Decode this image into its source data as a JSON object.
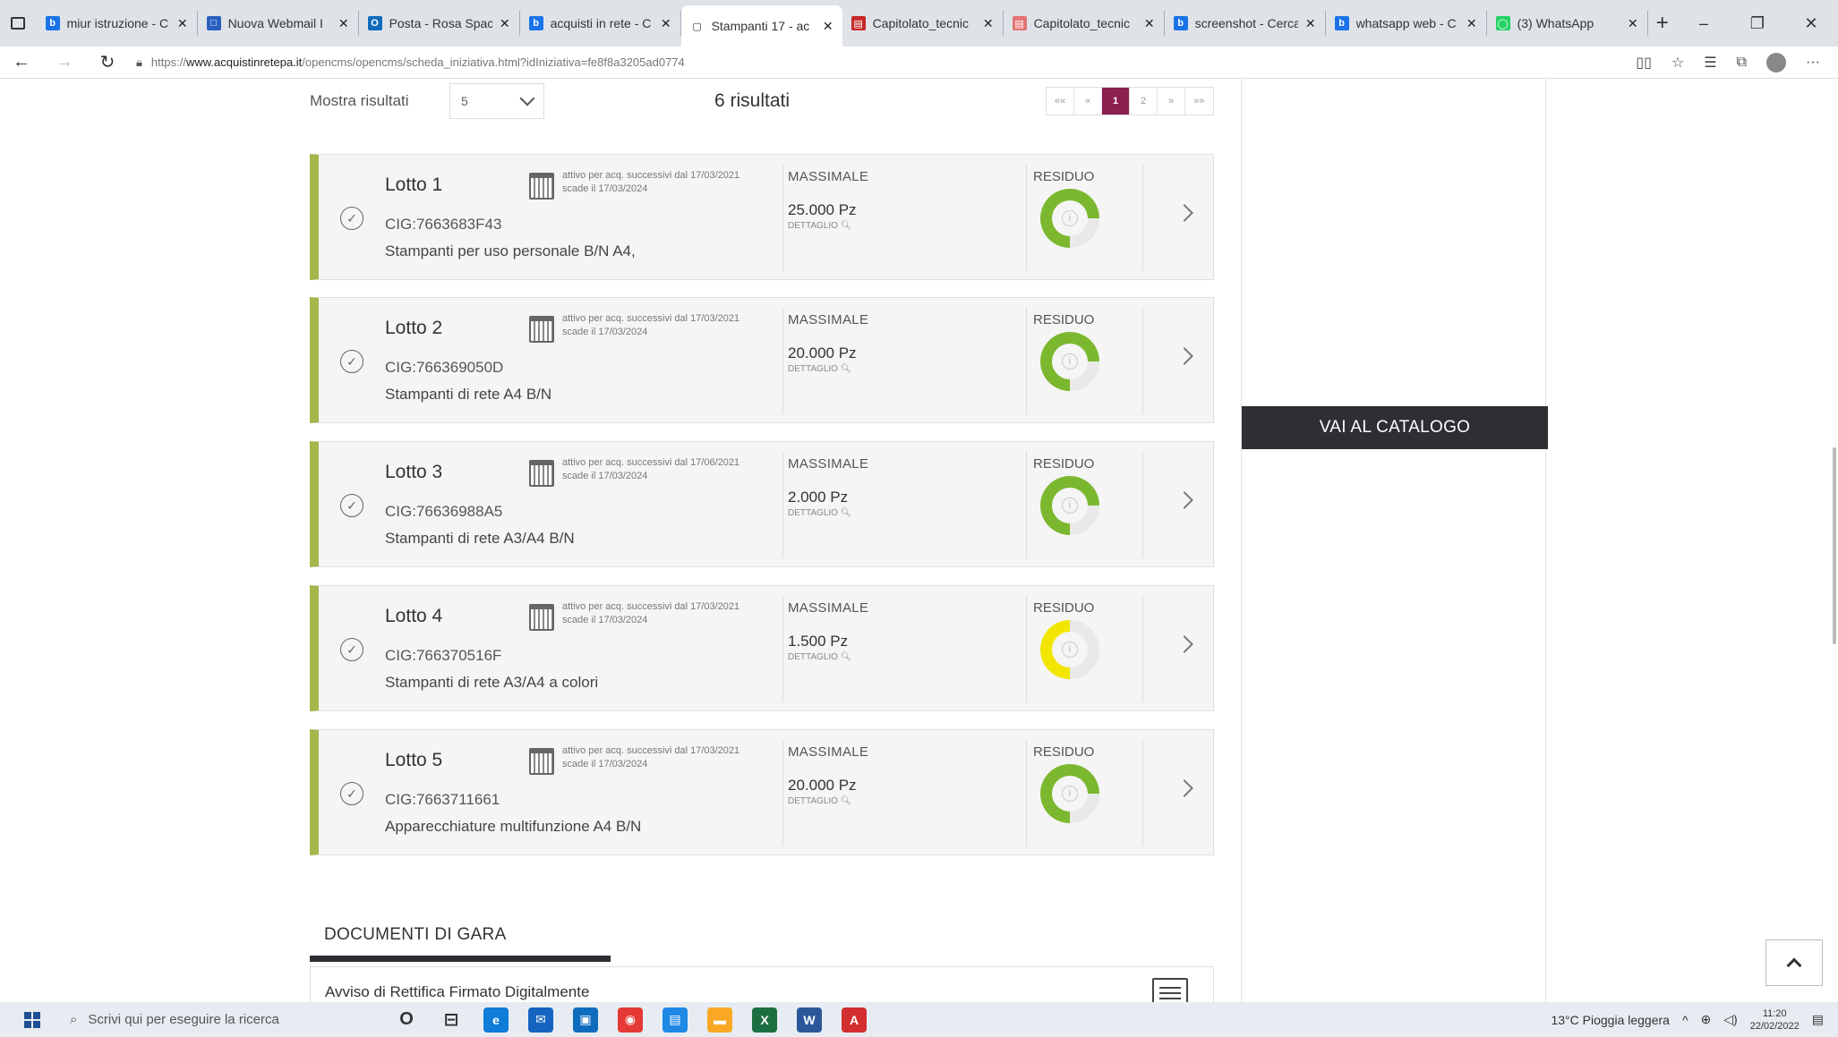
{
  "browser": {
    "tabs": [
      {
        "title": "miur istruzione - C",
        "color": "#1a73e8",
        "glyph": "b"
      },
      {
        "title": "Nuova Webmail I",
        "color": "#2b5fbf",
        "glyph": "□"
      },
      {
        "title": "Posta - Rosa Spac",
        "color": "#0f6cbd",
        "glyph": "O"
      },
      {
        "title": "acquisti in rete - C",
        "color": "#1a73e8",
        "glyph": "b"
      },
      {
        "title": "Stampanti 17 - ac",
        "color": "#ffffff",
        "glyph": "▢",
        "active": true
      },
      {
        "title": "Capitolato_tecnic",
        "color": "#c62828",
        "glyph": "▤"
      },
      {
        "title": "Capitolato_tecnic",
        "color": "#e57373",
        "glyph": "▤"
      },
      {
        "title": "screenshot - Cerca",
        "color": "#1a73e8",
        "glyph": "b"
      },
      {
        "title": "whatsapp web - C",
        "color": "#1a73e8",
        "glyph": "b"
      },
      {
        "title": "(3) WhatsApp",
        "color": "#25d366",
        "glyph": "◯"
      }
    ],
    "url_prefix": "https://",
    "url_domain": "www.acquistinretepa.it",
    "url_path": "/opencms/opencms/scheda_iniziativa.html?idIniziativa=fe8f8a3205ad0774"
  },
  "results": {
    "show_label": "Mostra risultati",
    "per_page": "5",
    "count_text": "6 risultati",
    "pager": [
      "««",
      "«",
      "1",
      "2",
      "»",
      "»»"
    ],
    "current_page": "1"
  },
  "lotti": [
    {
      "title": "Lotto 1",
      "cig": "CIG:7663683F43",
      "desc": "Stampanti per uso personale B/N A4,",
      "date1": "attivo per acq. successivi dal 17/03/2021",
      "date2": "scade il 17/03/2024",
      "massimale_label": "MASSIMALE",
      "massimale": "25.000 Pz",
      "dettaglio": "DETTAGLIO",
      "residuo_label": "RESIDUO",
      "residuo_pct": 0.75,
      "color": "#7cb82f"
    },
    {
      "title": "Lotto 2",
      "cig": "CIG:766369050D",
      "desc": "Stampanti di rete A4 B/N",
      "date1": "attivo per acq. successivi dal 17/03/2021",
      "date2": "scade il 17/03/2024",
      "massimale_label": "MASSIMALE",
      "massimale": "20.000 Pz",
      "dettaglio": "DETTAGLIO",
      "residuo_label": "RESIDUO",
      "residuo_pct": 0.75,
      "color": "#7cb82f"
    },
    {
      "title": "Lotto 3",
      "cig": "CIG:76636988A5",
      "desc": "Stampanti di rete A3/A4 B/N",
      "date1": "attivo per acq. successivi dal 17/06/2021",
      "date2": "scade il 17/03/2024",
      "massimale_label": "MASSIMALE",
      "massimale": "2.000 Pz",
      "dettaglio": "DETTAGLIO",
      "residuo_label": "RESIDUO",
      "residuo_pct": 0.75,
      "color": "#7cb82f"
    },
    {
      "title": "Lotto 4",
      "cig": "CIG:766370516F",
      "desc": "Stampanti di rete A3/A4 a colori",
      "date1": "attivo per acq. successivi dal 17/03/2021",
      "date2": "scade il 17/03/2024",
      "massimale_label": "MASSIMALE",
      "massimale": "1.500 Pz",
      "dettaglio": "DETTAGLIO",
      "residuo_label": "RESIDUO",
      "residuo_pct": 0.5,
      "color": "#f2e600"
    },
    {
      "title": "Lotto 5",
      "cig": "CIG:7663711661",
      "desc": "Apparecchiature multifunzione A4 B/N",
      "date1": "attivo per acq. successivi dal 17/03/2021",
      "date2": "scade il 17/03/2024",
      "massimale_label": "MASSIMALE",
      "massimale": "20.000 Pz",
      "dettaglio": "DETTAGLIO",
      "residuo_label": "RESIDUO",
      "residuo_pct": 0.75,
      "color": "#7cb82f"
    }
  ],
  "sidebar": {
    "catalog_button": "VAI AL CATALOGO"
  },
  "documents": {
    "heading": "DOCUMENTI DI GARA",
    "first_doc": "Avviso di Rettifica Firmato Digitalmente"
  },
  "taskbar": {
    "search_placeholder": "Scrivi qui per eseguire la ricerca",
    "weather": "13°C  Pioggia leggera",
    "time": "11:20",
    "date": "22/02/2022",
    "apps": [
      {
        "name": "cortana",
        "color": "#333333",
        "glyph": "O"
      },
      {
        "name": "task-view",
        "color": "#333333",
        "glyph": "⊟"
      },
      {
        "name": "edge",
        "color": "#0f7cd8",
        "glyph": "e"
      },
      {
        "name": "mail",
        "color": "#1565c0",
        "glyph": "✉"
      },
      {
        "name": "store",
        "color": "#0f6cbd",
        "glyph": "▣"
      },
      {
        "name": "chrome",
        "color": "#e53935",
        "glyph": "◉"
      },
      {
        "name": "save",
        "color": "#1e88e5",
        "glyph": "▤"
      },
      {
        "name": "explorer",
        "color": "#f9a825",
        "glyph": "▬"
      },
      {
        "name": "excel",
        "color": "#1d6f42",
        "glyph": "X"
      },
      {
        "name": "word",
        "color": "#2b579a",
        "glyph": "W"
      },
      {
        "name": "acrobat",
        "color": "#d32f2f",
        "glyph": "A"
      }
    ]
  }
}
